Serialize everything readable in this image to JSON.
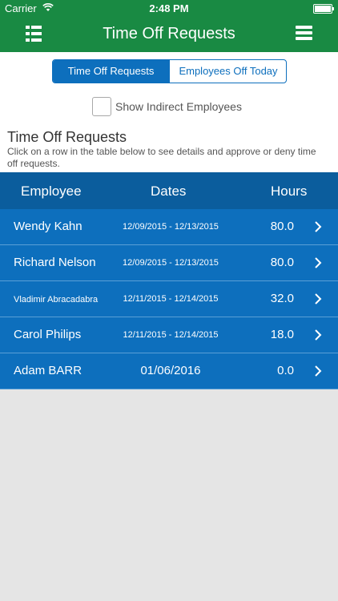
{
  "status_bar": {
    "carrier": "Carrier",
    "time": "2:48 PM"
  },
  "nav": {
    "title": "Time Off Requests"
  },
  "segmented": {
    "active": "Time Off Requests",
    "inactive": "Employees Off Today"
  },
  "filter": {
    "label": "Show Indirect Employees",
    "checked": false
  },
  "section": {
    "title": "Time Off Requests",
    "description": "Click on a row in the table below to see details and approve or deny time off requests."
  },
  "table": {
    "headers": {
      "employee": "Employee",
      "dates": "Dates",
      "hours": "Hours"
    },
    "rows": [
      {
        "employee": "Wendy Kahn",
        "dates": "12/09/2015 - 12/13/2015",
        "hours": "80.0"
      },
      {
        "employee": "Richard Nelson",
        "dates": "12/09/2015 - 12/13/2015",
        "hours": "80.0"
      },
      {
        "employee": "Vladimir Abracadabra",
        "dates": "12/11/2015 - 12/14/2015",
        "hours": "32.0"
      },
      {
        "employee": "Carol Philips",
        "dates": "12/11/2015 - 12/14/2015",
        "hours": "18.0"
      },
      {
        "employee": "Adam BARR",
        "dates": "01/06/2016",
        "hours": "0.0"
      }
    ]
  },
  "colors": {
    "nav_green": "#198a43",
    "row_blue": "#0d6fbd",
    "header_blue": "#0b5d9d"
  }
}
